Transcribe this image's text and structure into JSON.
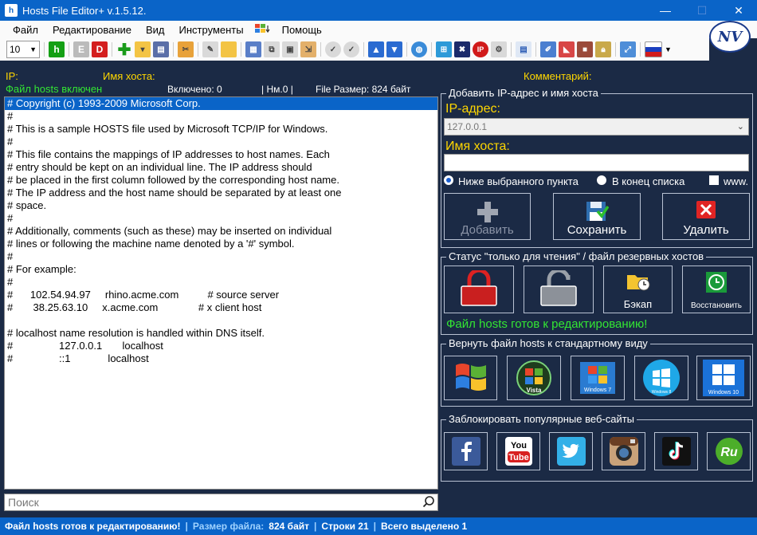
{
  "window": {
    "title": "Hosts File Editor+ v.1.5.12.",
    "minimize": "—",
    "maximize": "☐",
    "close": "✕"
  },
  "menu": [
    "Файл",
    "Редактирование",
    "Вид",
    "Инструменты",
    "Помощь"
  ],
  "logo_text": "NV",
  "toolbar": {
    "font_size": "10",
    "h_label": "h",
    "e_label": "E",
    "d_label": "D",
    "ip_label": "IP"
  },
  "header": {
    "ip_label": "IP:",
    "host_label": "Имя хоста:",
    "comment_label": "Комментарий:",
    "status_label": "Файл hosts включен",
    "enabled": "Включено: 0",
    "nm": "| Нм.0 |",
    "file_size": "File Размер: 824 байт"
  },
  "editor": {
    "lines": [
      "# Copyright (c) 1993-2009 Microsoft Corp.",
      "#",
      "# This is a sample HOSTS file used by Microsoft TCP/IP for Windows.",
      "#",
      "# This file contains the mappings of IP addresses to host names. Each",
      "# entry should be kept on an individual line. The IP address should",
      "# be placed in the first column followed by the corresponding host name.",
      "# The IP address and the host name should be separated by at least one",
      "# space.",
      "#",
      "# Additionally, comments (such as these) may be inserted on individual",
      "# lines or following the machine name denoted by a '#' symbol.",
      "#",
      "# For example:",
      "#",
      "#      102.54.94.97     rhino.acme.com          # source server",
      "#       38.25.63.10     x.acme.com              # x client host",
      "",
      "# localhost name resolution is handled within DNS itself.",
      "#                127.0.0.1       localhost",
      "#                ::1             localhost"
    ]
  },
  "search": {
    "placeholder": "Поиск"
  },
  "add_panel": {
    "title": "Добавить IP-адрес и имя хоста",
    "ip_label": "IP-адрес:",
    "ip_value": "127.0.0.1",
    "host_label": "Имя хоста:",
    "host_value": "",
    "radio_below": "Ниже выбранного пункта",
    "radio_end": "В конец списка",
    "www": "www.",
    "add_button": "Добавить",
    "save_button": "Сохранить",
    "delete_button": "Удалить"
  },
  "readonly_panel": {
    "title": "Статус \"только для чтения\" / файл резервных хостов",
    "backup_button": "Бэкап",
    "restore_button": "Восстановить",
    "status_text": "Файл hosts готов к редактированию!"
  },
  "restore_panel": {
    "title": "Вернуть файл hosts к стандартному виду",
    "tiles": [
      "Windows XP",
      "Vista",
      "Windows 7",
      "Windows 8",
      "Windows 10"
    ]
  },
  "block_panel": {
    "title": "Заблокировать популярные веб-сайты",
    "sites": [
      "Facebook",
      "YouTube",
      "Twitter",
      "Instagram",
      "TikTok",
      "Rutube"
    ]
  },
  "statusbar": {
    "message": "Файл hosts готов к редактированию!",
    "size_label": "Размер файла:",
    "size_value": "824 байт",
    "lines": "Строки 21",
    "selected": "Всего выделено 1"
  },
  "colors": {
    "background": "#1b2a45",
    "accent": "#0a64c8",
    "label_yellow": "#ffd700",
    "status_green": "#33e633"
  }
}
